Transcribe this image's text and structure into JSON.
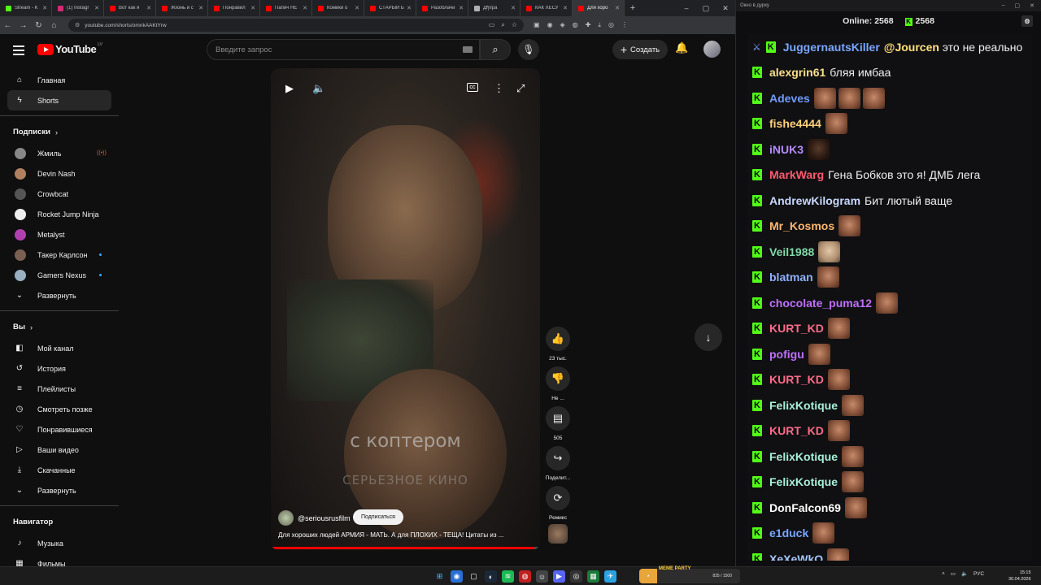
{
  "browser": {
    "tabs": [
      {
        "label": "Stream - K",
        "color": "#53fc18"
      },
      {
        "label": "(1) Instagr",
        "color": "#d62976"
      },
      {
        "label": "Вот как я",
        "color": "#ff0000"
      },
      {
        "label": "Жизнь и с",
        "color": "#ff0000"
      },
      {
        "label": "Понравил",
        "color": "#ff0000"
      },
      {
        "label": "Папич НЕ",
        "color": "#ff0000"
      },
      {
        "label": "Комики о",
        "color": "#ff0000"
      },
      {
        "label": "СТАРЫЙ Б",
        "color": "#ff0000"
      },
      {
        "label": "Разоблачи",
        "color": "#ff0000"
      },
      {
        "label": "Дђ¤рa",
        "color": "#b0b0b0"
      },
      {
        "label": "КАК ХЕСУ",
        "color": "#ff0000"
      },
      {
        "label": "Для хоро",
        "color": "#ff0000",
        "active": true
      }
    ],
    "new_tab": "+",
    "window_controls": [
      "–",
      "▢",
      "✕"
    ],
    "url": "youtube.com/shorts/omnkAAKtYrw"
  },
  "youtube": {
    "logo_text": "YouTube",
    "country_code": "LV",
    "search_placeholder": "Введите запрос",
    "create_label": "Создать",
    "sidebar": {
      "main": [
        {
          "label": "Главная",
          "icon": "home-icon"
        },
        {
          "label": "Shorts",
          "icon": "shorts-icon",
          "active": true
        }
      ],
      "subscriptions_title": "Подписки",
      "subscriptions": [
        {
          "label": "Жмиль",
          "color": "#888888",
          "live": true
        },
        {
          "label": "Devin Nash",
          "color": "#b08060"
        },
        {
          "label": "Crowbcat",
          "color": "#555555"
        },
        {
          "label": "Rocket Jump Ninja",
          "color": "#eeeeee"
        },
        {
          "label": "Metalyst",
          "color": "#b040b0"
        },
        {
          "label": "Такер Карлсон",
          "color": "#7a6050",
          "new": true
        },
        {
          "label": "Gamers Nexus",
          "color": "#9ab0c0",
          "new": true
        },
        {
          "label": "Развернуть",
          "expand": true
        }
      ],
      "you_title": "Вы",
      "you": [
        {
          "label": "Мой канал",
          "icon": "my-channel-icon"
        },
        {
          "label": "История",
          "icon": "history-icon"
        },
        {
          "label": "Плейлисты",
          "icon": "playlists-icon"
        },
        {
          "label": "Смотреть позже",
          "icon": "watch-later-icon"
        },
        {
          "label": "Понравившиеся",
          "icon": "liked-icon"
        },
        {
          "label": "Ваши видео",
          "icon": "your-videos-icon"
        },
        {
          "label": "Скачанные",
          "icon": "downloads-icon"
        },
        {
          "label": "Развернуть",
          "icon": "chevron-down-icon"
        }
      ],
      "navigator_title": "Навигатор",
      "navigator": [
        {
          "label": "Музыка",
          "icon": "music-icon"
        },
        {
          "label": "Фильмы",
          "icon": "movies-icon"
        }
      ]
    },
    "player": {
      "subtitle": "с коптером",
      "watermark": "СЕРЬЕЗНОЕ КИНО",
      "channel": "@seriousrusfilm",
      "subscribe_label": "Подписаться",
      "title": "Для хороших людей АРМИЯ - МАТЬ. А для ПЛОХИХ - ТЕЩА! Цитаты из ...",
      "progress_pct": 98
    },
    "actions": {
      "likes": "23 тыс.",
      "dislike": "Не ...",
      "comments": "505",
      "share": "Поделит...",
      "remix": "Ремикс"
    }
  },
  "chat": {
    "window_title": "Окно в дурку",
    "online_label": "Online:",
    "online_count": "2568",
    "kick_count": "2568",
    "messages": [
      {
        "user": "JuggernautsKiller",
        "color": "#7aa7ff",
        "text": "@Jourcen это не реально",
        "mention": "@Jourcen",
        "sword": true,
        "emotes": []
      },
      {
        "user": "alexgrin61",
        "color": "#f8e08a",
        "text": "бляя имбаа",
        "emotes": []
      },
      {
        "user": "Adeves",
        "color": "#6f9bff",
        "text": "",
        "emotes": [
          "a",
          "a",
          "a"
        ]
      },
      {
        "user": "fishe4444",
        "color": "#ffd27a",
        "text": "",
        "emotes": [
          "a"
        ]
      },
      {
        "user": "iNUK3",
        "color": "#b58cff",
        "text": "",
        "emotes": [
          "dark"
        ]
      },
      {
        "user": "MarkWarg",
        "color": "#ff5a6e",
        "text": "Гена Бобков это я! ДМБ лега",
        "emotes": []
      },
      {
        "user": "AndrewKilogram",
        "color": "#c8d8ff",
        "text": "Бит лютый ваще",
        "emotes": []
      },
      {
        "user": "Mr_Kosmos",
        "color": "#ffb870",
        "text": "",
        "emotes": [
          "a"
        ]
      },
      {
        "user": "Veil1988",
        "color": "#80d8a8",
        "text": "",
        "emotes": [
          "pale"
        ]
      },
      {
        "user": "blatman",
        "color": "#8fb0ff",
        "text": "",
        "emotes": [
          "a"
        ]
      },
      {
        "user": "chocolate_puma12",
        "color": "#c070ff",
        "text": "",
        "emotes": [
          "a"
        ]
      },
      {
        "user": "KURT_KD",
        "color": "#ff6b8a",
        "text": "",
        "emotes": [
          "a"
        ]
      },
      {
        "user": "pofigu",
        "color": "#c070ff",
        "text": "",
        "emotes": [
          "a"
        ]
      },
      {
        "user": "KURT_KD",
        "color": "#ff6b8a",
        "text": "",
        "emotes": [
          "a"
        ]
      },
      {
        "user": "FelixKotique",
        "color": "#a8f0d8",
        "text": "",
        "emotes": [
          "a"
        ]
      },
      {
        "user": "KURT_KD",
        "color": "#ff6b8a",
        "text": "",
        "emotes": [
          "a"
        ]
      },
      {
        "user": "FelixKotique",
        "color": "#a8f0d8",
        "text": "",
        "emotes": [
          "a"
        ]
      },
      {
        "user": "FelixKotique",
        "color": "#a8f0d8",
        "text": "",
        "emotes": [
          "a"
        ]
      },
      {
        "user": "DonFalcon69",
        "color": "#ffffff",
        "text": "",
        "emotes": [
          "a"
        ]
      },
      {
        "user": "e1duck",
        "color": "#7aa7ff",
        "text": "",
        "emotes": [
          "a"
        ]
      },
      {
        "user": "XeXeWkO",
        "color": "#a8c8ff",
        "text": "",
        "emotes": [
          "a"
        ]
      }
    ]
  },
  "taskbar": {
    "widget_title": "MEME PARTY",
    "widget_value": "835 / 1500",
    "tray_lang": "РУС",
    "time": "15:15",
    "date": "30.04.2026"
  }
}
